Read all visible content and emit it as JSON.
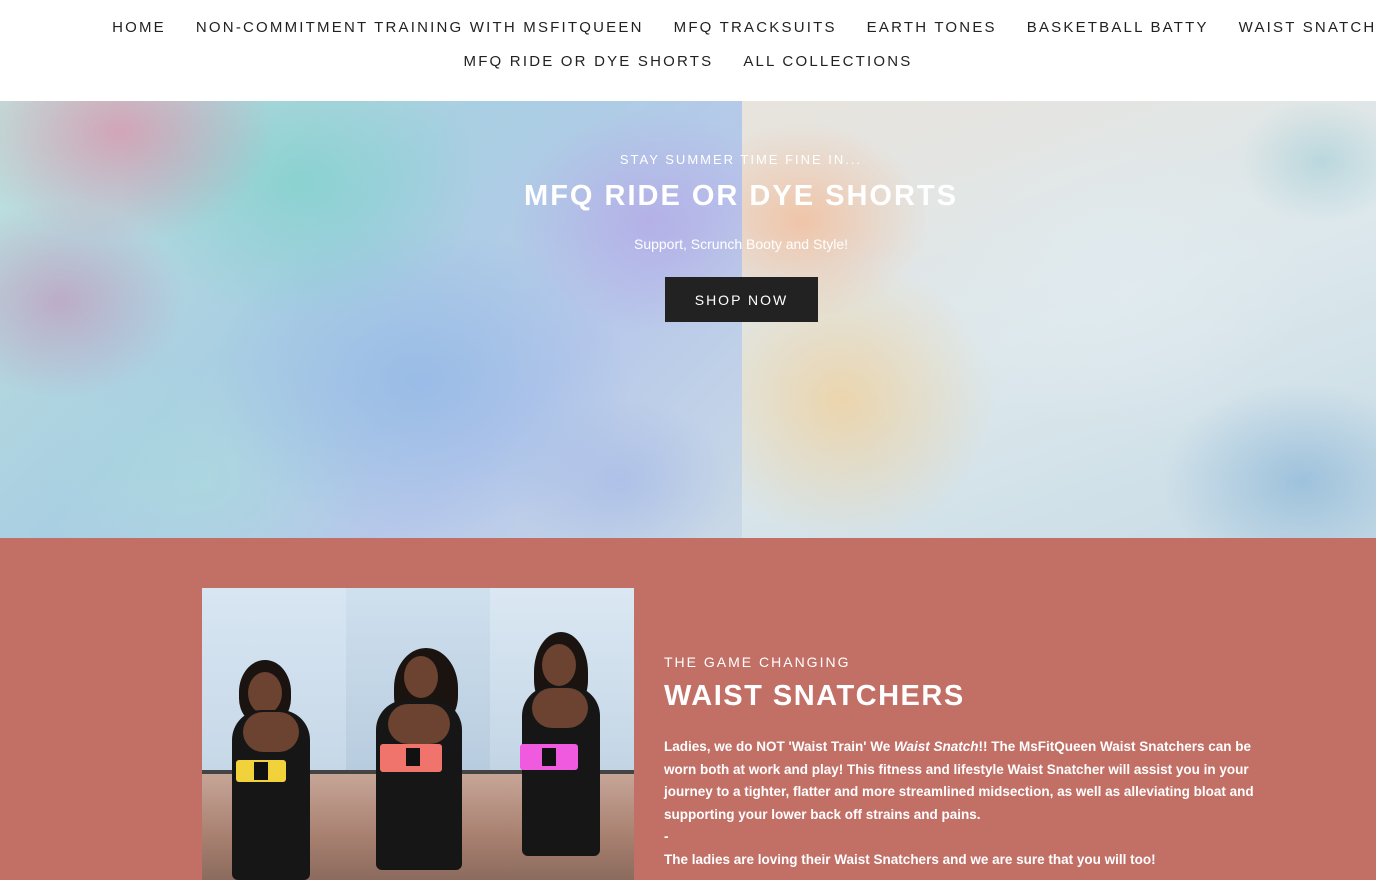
{
  "nav": {
    "row1": [
      "HOME",
      "NON-COMMITMENT TRAINING WITH MSFITQUEEN",
      "MFQ TRACKSUITS",
      "EARTH TONES",
      "BASKETBALL BATTY",
      "WAIST SNATCHERS"
    ],
    "row2": [
      "MFQ RIDE OR DYE SHORTS",
      "ALL COLLECTIONS"
    ]
  },
  "hero": {
    "kicker": "STAY SUMMER TIME FINE IN...",
    "title": "MFQ RIDE OR DYE SHORTS",
    "subtitle": "Support, Scrunch Booty and Style!",
    "button": "SHOP NOW"
  },
  "promo": {
    "kicker": "THE GAME CHANGING",
    "title": "WAIST SNATCHERS",
    "body_prefix": "Ladies, we do NOT 'Waist Train' We ",
    "body_em": "Waist Snatch",
    "body_suffix": "!! The MsFitQueen Waist Snatchers can be worn both at work and play! This fitness and lifestyle Waist Snatcher will assist you in your journey to a tighter, flatter and more streamlined midsection, as well as alleviating bloat and supporting your lower back off strains and pains.",
    "dash": "-",
    "body2": "The ladies are loving their Waist Snatchers and we are sure that you will too!"
  },
  "colors": {
    "promo_bg": "#c26f66",
    "button_bg": "#222222",
    "belt_yellow": "#f2d23a",
    "belt_coral": "#f0746b",
    "belt_pink": "#f05adf"
  }
}
